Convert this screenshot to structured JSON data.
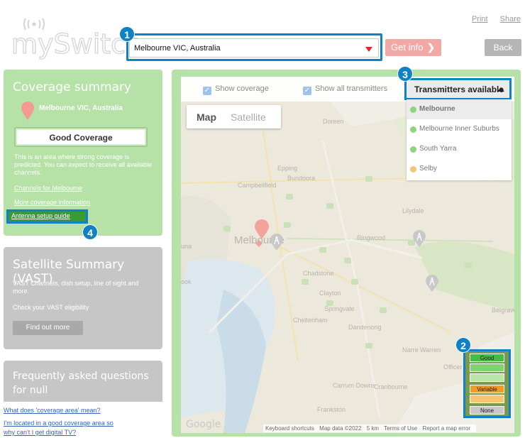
{
  "header": {
    "logo_text": "mySwitch",
    "print_label": "Print",
    "share_label": "Share",
    "search_value": "Melbourne VIC, Australia",
    "get_info_label": "Get info",
    "back_label": "Back"
  },
  "badges": {
    "b1": "1",
    "b2": "2",
    "b3": "3",
    "b4": "4"
  },
  "coverage": {
    "title": "Coverage summary",
    "place": "Melbourne VIC, Australia",
    "status": "Good Coverage",
    "description": "This is an area where strong coverage is predicted. You can expect to receive all available channels.",
    "links": [
      "Channels for Melbourne",
      "More coverage information",
      "Antenna setup guide"
    ]
  },
  "vast": {
    "title": "Satellite Summary (VAST)",
    "line1": "VAST Channels, dish setup, line of sight and more.",
    "line2": "Check your VAST eligibility",
    "button": "Find out more"
  },
  "faq": {
    "title": "Frequently asked questions for null",
    "q1": "What does 'coverage area' mean?",
    "q2a": "I'm located in a good coverage area so",
    "q2b": "why can't I get digital TV?"
  },
  "map": {
    "show_coverage": "Show coverage",
    "show_all": "Show all transmitters",
    "type_map": "Map",
    "type_satellite": "Satellite",
    "transmitters_label": "Transmitters available",
    "transmitters": [
      {
        "name": "Melbourne",
        "color": "#8fd47f"
      },
      {
        "name": "Melbourne Inner Suburbs",
        "color": "#8fd47f"
      },
      {
        "name": "South Yarra",
        "color": "#8fd47f"
      },
      {
        "name": "Selby",
        "color": "#f6c27a"
      }
    ],
    "places": {
      "doreen": "Doreen",
      "epping": "Epping",
      "campbellfield": "Campbellfield",
      "bundoora": "Bundoora",
      "lilydale": "Lilydale",
      "melbourne": "Melbourne",
      "ringwood": "Ringwood",
      "chadstone": "Chadstone",
      "clayton": "Clayton",
      "springvale": "Springvale",
      "cheltenham": "Cheltenham",
      "dandenong": "Dandenong",
      "narre": "Narre Warren",
      "cranbourne": "Cranbourne",
      "carrum": "Carrum Downs",
      "frankston": "Frankston",
      "officer": "Officer",
      "belgrave": "Belgrave",
      "una": "una",
      "rook": "ook"
    },
    "legend": [
      "Good",
      "Variable",
      "None"
    ],
    "legend_colors": {
      "good": "#3fbf3f",
      "variable": "#f29c28",
      "none": "#c8c8c8"
    },
    "google": "Google",
    "attribution": [
      "Keyboard shortcuts",
      "Map data ©2022",
      "5 km",
      "Terms of Use",
      "Report a map error"
    ]
  }
}
